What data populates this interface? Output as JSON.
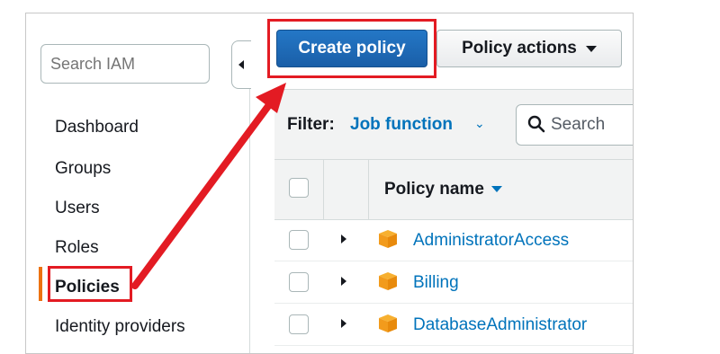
{
  "sidebar": {
    "search_placeholder": "Search IAM",
    "items": [
      {
        "label": "Dashboard"
      },
      {
        "label": "Groups"
      },
      {
        "label": "Users"
      },
      {
        "label": "Roles"
      },
      {
        "label": "Policies",
        "active": true
      },
      {
        "label": "Identity providers"
      }
    ]
  },
  "toolbar": {
    "create_label": "Create policy",
    "actions_label": "Policy actions"
  },
  "filter": {
    "label": "Filter:",
    "value": "Job function",
    "search_placeholder": "Search"
  },
  "table": {
    "column_name": "Policy name",
    "rows": [
      {
        "name": "AdministratorAccess"
      },
      {
        "name": "Billing"
      },
      {
        "name": "DatabaseAdministrator"
      }
    ]
  },
  "colors": {
    "accent": "#ec7211",
    "primary_button": "#1a6fbf",
    "link": "#0073bb",
    "highlight": "#e31b23"
  }
}
